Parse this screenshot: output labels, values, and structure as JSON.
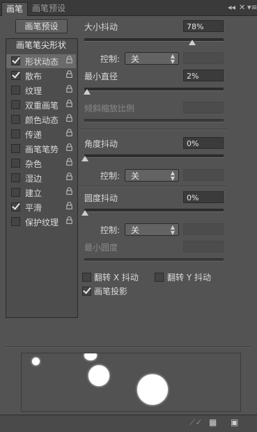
{
  "tabs": [
    {
      "label": "画笔",
      "active": true
    },
    {
      "label": "画笔预设",
      "active": false
    }
  ],
  "preset_button": "画笔预设",
  "list": {
    "header": "画笔笔尖形状",
    "items": [
      {
        "label": "形状动态",
        "checked": true,
        "selected": true
      },
      {
        "label": "散布",
        "checked": true,
        "selected": false
      },
      {
        "label": "纹理",
        "checked": false,
        "selected": false
      },
      {
        "label": "双重画笔",
        "checked": false,
        "selected": false
      },
      {
        "label": "颜色动态",
        "checked": false,
        "selected": false
      },
      {
        "label": "传递",
        "checked": false,
        "selected": false
      },
      {
        "label": "画笔笔势",
        "checked": false,
        "selected": false
      },
      {
        "label": "杂色",
        "checked": false,
        "selected": false
      },
      {
        "label": "湿边",
        "checked": false,
        "selected": false
      },
      {
        "label": "建立",
        "checked": false,
        "selected": false
      },
      {
        "label": "平滑",
        "checked": true,
        "selected": false
      },
      {
        "label": "保护纹理",
        "checked": false,
        "selected": false
      }
    ]
  },
  "size_jitter": {
    "label": "大小抖动",
    "value": "78%",
    "level": 0.78
  },
  "control1": {
    "label": "控制:",
    "value": "关"
  },
  "min_diameter": {
    "label": "最小直径",
    "value": "2%",
    "level": 0.02
  },
  "tilt_scale": {
    "label": "倾斜缩放比例"
  },
  "angle_jitter": {
    "label": "角度抖动",
    "value": "0%",
    "level": 0.0
  },
  "control2": {
    "label": "控制:",
    "value": "关"
  },
  "roundness_jitter": {
    "label": "圆度抖动",
    "value": "0%",
    "level": 0.0
  },
  "control3": {
    "label": "控制:",
    "value": "关"
  },
  "min_roundness": {
    "label": "最小圆度"
  },
  "flip_x": {
    "label": "翻转 X 抖动",
    "checked": false
  },
  "flip_y": {
    "label": "翻转 Y 抖动",
    "checked": false
  },
  "brush_projection": {
    "label": "画笔投影",
    "checked": true
  }
}
